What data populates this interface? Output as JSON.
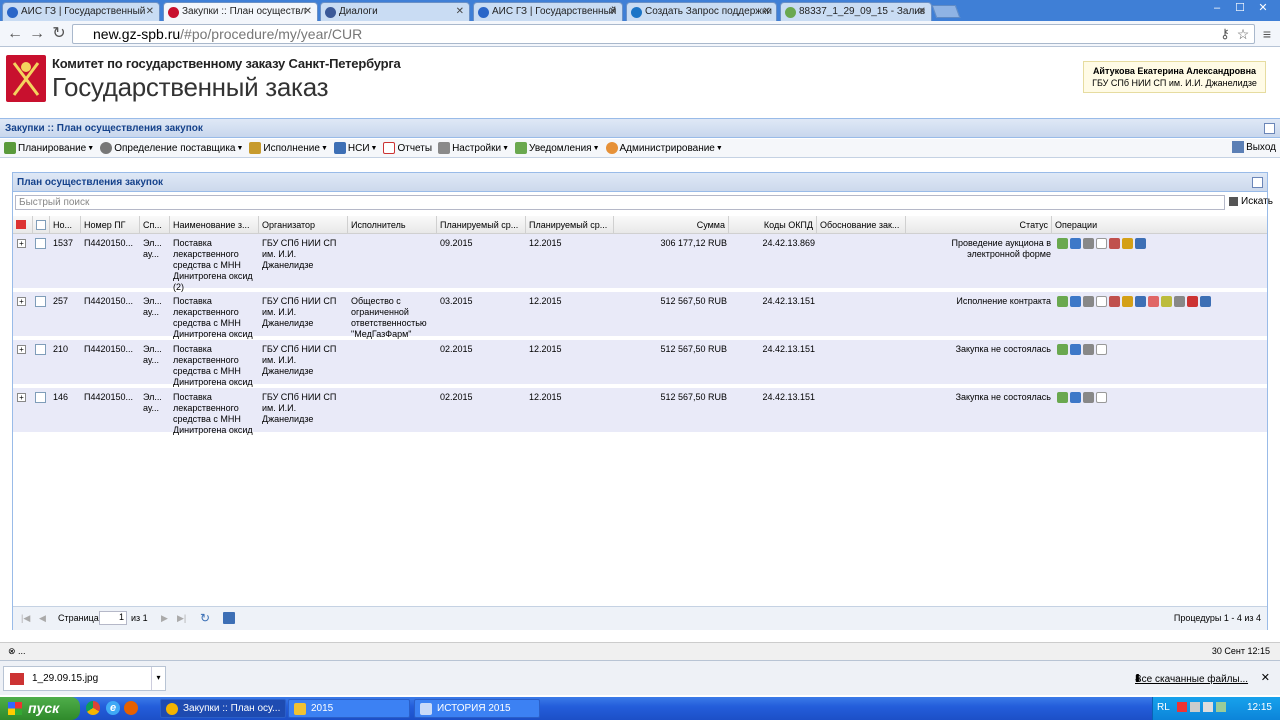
{
  "browser": {
    "tabs": [
      {
        "label": "АИС ГЗ | Государственный",
        "active": false
      },
      {
        "label": "Закупки :: План осуществл",
        "active": true
      },
      {
        "label": "Диалоги",
        "active": false
      },
      {
        "label": "АИС ГЗ | Государственный",
        "active": false
      },
      {
        "label": "Создать Запрос поддержки",
        "active": false
      },
      {
        "label": "88337_1_29_09_15 - Залив",
        "active": false
      }
    ],
    "url_host": "new.gz-spb.ru",
    "url_path": "/#po/procedure/my/year/CUR"
  },
  "header": {
    "org_line1": "Комитет по государственному заказу Санкт-Петербурга",
    "org_line2": "Государственный заказ",
    "user_name": "Айтукова Екатерина Александровна",
    "user_org": "ГБУ СПб НИИ СП им. И.И. Джанелидзе"
  },
  "panel_title": "Закупки :: План осуществления закупок",
  "menu": [
    {
      "label": "Планирование",
      "dropdown": true
    },
    {
      "label": "Определение поставщика",
      "dropdown": true
    },
    {
      "label": "Исполнение",
      "dropdown": true
    },
    {
      "label": "НСИ",
      "dropdown": true
    },
    {
      "label": "Отчеты",
      "dropdown": false
    },
    {
      "label": "Настройки",
      "dropdown": true
    },
    {
      "label": "Уведомления",
      "dropdown": true
    },
    {
      "label": "Администрирование",
      "dropdown": true
    }
  ],
  "logout_label": "Выход",
  "grid": {
    "title": "План осуществления закупок",
    "search_placeholder": "Быстрый поиск",
    "search_button": "Искать",
    "columns": [
      "Но...",
      "Номер ПГ",
      "Сп...",
      "Наименование з...",
      "Организатор",
      "Исполнитель",
      "Планируемый ср...",
      "Планируемый ср...",
      "Сумма",
      "Коды ОКПД",
      "Обоснование зак...",
      "Статус",
      "Операции"
    ],
    "rows": [
      {
        "no": "1537",
        "pg": "П4420150...",
        "sp": "Эл... ау...",
        "name": "Поставка лекарственного средства с МНН Динитрогена оксид (2)",
        "org": "ГБУ СПб НИИ СП им. И.И. Джанелидзе",
        "exec": "",
        "plan1": "09.2015",
        "plan2": "12.2015",
        "sum": "306 177,12 RUB",
        "okpd": "24.42.13.869",
        "reason": "",
        "status": "Проведение аукциона в электронной форме",
        "ops": 7
      },
      {
        "no": "257",
        "pg": "П4420150...",
        "sp": "Эл... ау...",
        "name": "Поставка лекарственного средства с МНН Динитрогена оксид",
        "org": "ГБУ СПб НИИ СП им. И.И. Джанелидзе",
        "exec": "Общество с ограниченной ответственностью \"МедГазФарм\"",
        "plan1": "03.2015",
        "plan2": "12.2015",
        "sum": "512 567,50 RUB",
        "okpd": "24.42.13.151",
        "reason": "",
        "status": "Исполнение контракта",
        "ops": 12
      },
      {
        "no": "210",
        "pg": "П4420150...",
        "sp": "Эл... ау...",
        "name": "Поставка лекарственного средства с МНН Динитрогена оксид",
        "org": "ГБУ СПб НИИ СП им. И.И. Джанелидзе",
        "exec": "",
        "plan1": "02.2015",
        "plan2": "12.2015",
        "sum": "512 567,50 RUB",
        "okpd": "24.42.13.151",
        "reason": "",
        "status": "Закупка не состоялась",
        "ops": 4
      },
      {
        "no": "146",
        "pg": "П4420150...",
        "sp": "Эл... ау...",
        "name": "Поставка лекарственного средства с МНН Динитрогена оксид",
        "org": "ГБУ СПб НИИ СП им. И.И. Джанелидзе",
        "exec": "",
        "plan1": "02.2015",
        "plan2": "12.2015",
        "sum": "512 567,50 RUB",
        "okpd": "24.42.13.151",
        "reason": "",
        "status": "Закупка не состоялась",
        "ops": 4
      }
    ],
    "pager": {
      "page_label": "Страница",
      "page_value": "1",
      "of_label": "из 1",
      "summary": "Процедуры 1 - 4 из 4"
    }
  },
  "statusbar": {
    "left": "...",
    "right": "30 Сент 12:15"
  },
  "downloads": {
    "file": "1_29.09.15.jpg",
    "all_label": "Все скачанные файлы..."
  },
  "taskbar": {
    "start_label": "пуск",
    "items": [
      "Закупки :: План осу...",
      "2015",
      "ИСТОРИЯ 2015"
    ],
    "lang": "RL",
    "clock": "12:15"
  }
}
